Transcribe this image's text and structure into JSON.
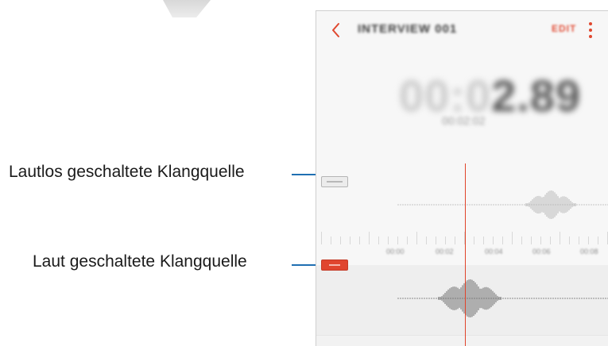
{
  "callouts": {
    "muted_source": "Lautlos geschaltete Klangquelle",
    "active_source": "Laut geschaltete Klangquelle"
  },
  "recorder": {
    "title": "INTERVIEW 001",
    "edit_label": "EDIT",
    "timer_dim": "00:0",
    "timer_strong": "2.89",
    "subtime": "00:02:02",
    "timeline_labels": [
      "00:00",
      "00:02",
      "00:04",
      "00:06",
      "00:08"
    ],
    "tracks": [
      {
        "name": "track-muted",
        "badge_color": "#ececec",
        "state": "muted"
      },
      {
        "name": "track-active",
        "badge_color": "#e0452f",
        "state": "active"
      }
    ]
  },
  "colors": {
    "accent": "#e0482f",
    "callout_line": "#1f6fb2"
  },
  "icons": {
    "back": "chevron-left-icon",
    "more": "more-vertical-icon"
  }
}
